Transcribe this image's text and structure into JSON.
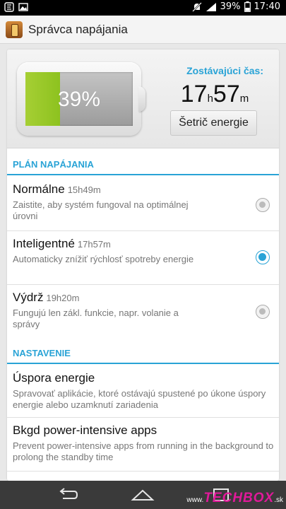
{
  "status_bar": {
    "battery_percent": "39%",
    "time": "17:40",
    "icons": [
      "notification-icon",
      "image-icon",
      "mute-icon",
      "signal-icon",
      "battery-icon"
    ]
  },
  "header": {
    "title": "Správca napájania",
    "app_icon": "battery-manager-icon"
  },
  "battery": {
    "level_fraction": 0.32,
    "percent_label": "39%",
    "remaining_label": "Zostávajúci čas:",
    "hours": "17",
    "hours_unit": "h",
    "minutes": "57",
    "minutes_unit": "m",
    "saver_button": "Šetrič energie"
  },
  "plan_section": {
    "title": "PLÁN NAPÁJANIA",
    "items": [
      {
        "name": "Normálne",
        "duration": "15h49m",
        "desc": "Zaistite, aby systém fungoval na optimálnej úrovni",
        "selected": false
      },
      {
        "name": "Inteligentné",
        "duration": "17h57m",
        "desc": "Automaticky znížiť rýchlosť spotreby energie",
        "selected": true
      },
      {
        "name": "Výdrž",
        "duration": "19h20m",
        "desc": "Fungujú len zákl. funkcie, napr. volanie a správy",
        "selected": false
      }
    ]
  },
  "settings_section": {
    "title": "NASTAVENIE",
    "items": [
      {
        "title": "Úspora energie",
        "desc": "Spravovať aplikácie, ktoré ostávajú spustené po úkone úspory energie alebo uzamknutí zariadenia"
      },
      {
        "title": "Bkgd power-intensive apps",
        "desc": "Prevent power-intensive apps from running in the background to prolong the standby time"
      }
    ]
  },
  "nav_bar": {
    "icons": [
      "back-icon",
      "home-icon",
      "recent-apps-icon"
    ]
  },
  "watermark": {
    "prefix": "www.",
    "brand": "TECHBOX",
    "suffix": ".sk"
  },
  "colors": {
    "accent": "#29a3d6",
    "battery_green": "#8dc21f",
    "watermark_pink": "#e0199a"
  }
}
